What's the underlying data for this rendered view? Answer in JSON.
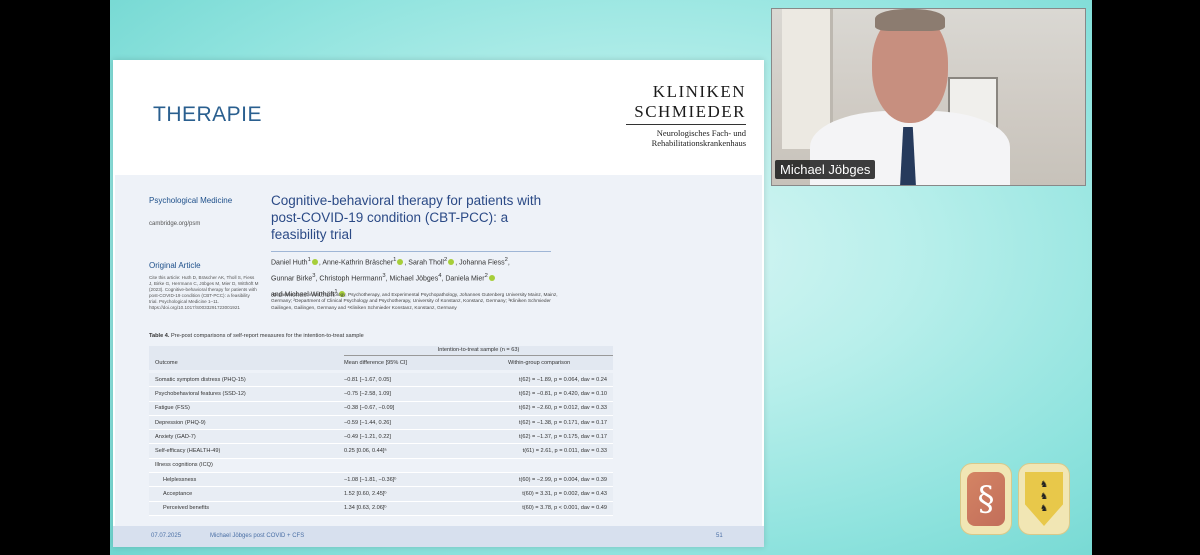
{
  "slide": {
    "title": "THERAPIE",
    "logo": {
      "line1": "KLINIKEN",
      "line2": "SCHMIEDER",
      "sub1": "Neurologisches Fach- und",
      "sub2": "Rehabilitationskrankenhaus"
    },
    "paper": {
      "journal": "Psychological Medicine",
      "journal_url": "cambridge.org/psm",
      "article_type": "Original Article",
      "citation": "Cite this article: Huth D, Bräscher AK, Tholl S, Fiess J, Birke G, Herrmann C, Jöbges M, Mier D, Witthöft M (2023). Cognitive-behavioral therapy for patients with post-COVID-19 condition (CBT-PCC): a feasibility trial. Psychological Medicine 1–11. https://doi.org/10.1017/S0033291723001921",
      "title": "Cognitive-behavioral therapy for patients with post-COVID-19 condition (CBT-PCC): a feasibility trial",
      "authors_line1a": "Daniel Huth",
      "authors_line1b": ", Anne-Kathrin Bräscher",
      "authors_line1c": ", Sarah Tholl",
      "authors_line1d": ", Johanna Fiess",
      "authors_line2a": "Gunnar Birke",
      "authors_line2b": ", Christoph Herrmann",
      "authors_line2c": ", Michael Jöbges",
      "authors_line2d": ", Daniela Mier",
      "authors_line3a": "and Michael Witthöft",
      "affiliations": "¹Department of Clinical Psychology, Psychotherapy, and Experimental Psychopathology, Johannes Gutenberg University Mainz, Mainz, Germany; ²Department of Clinical Psychology and Psychotherapy, University of Konstanz, Konstanz, Germany; ³Kliniken Schmieder Gailingen, Gailingen, Germany and ⁴Kliniken Schmieder Konstanz, Konstanz, Germany"
    },
    "table": {
      "caption_bold": "Table 4.",
      "caption_rest": " Pre-post comparisons of self-report measures for the intention-to-treat sample",
      "group_header": "Intention-to-treat sample (n = 63)",
      "headers": {
        "outcome": "Outcome",
        "mean": "Mean difference [95% CI]",
        "within": "Within-group comparison"
      },
      "rows": [
        {
          "outcome": "Somatic symptom distress (PHQ-15)",
          "mean": "−0.81 [−1.67, 0.05]",
          "within": "t(62) = −1.89, p = 0.064, dav = 0.24"
        },
        {
          "outcome": "Psychobehavioral features (SSD-12)",
          "mean": "−0.75 [−2.58, 1.09]",
          "within": "t(62) = −0.81, p = 0.420, dav = 0.10"
        },
        {
          "outcome": "Fatigue (FSS)",
          "mean": "−0.38 [−0.67, −0.09]",
          "within": "t(62) = −2.60, p = 0.012, dav = 0.33"
        },
        {
          "outcome": "Depression (PHQ-9)",
          "mean": "−0.59 [−1.44, 0.26]",
          "within": "t(62) = −1.38, p = 0.171, dav = 0.17"
        },
        {
          "outcome": "Anxiety (GAD-7)",
          "mean": "−0.49 [−1.21, 0.22]",
          "within": "t(62) = −1.37, p = 0.175, dav = 0.17"
        },
        {
          "outcome": "Self-efficacy (HEALTH-49)",
          "mean": "0.25 [0.06, 0.44]ᵃ",
          "within": "t(61) = 2.61, p = 0.011, dav = 0.33"
        },
        {
          "outcome": "Illness cognitions (ICQ)",
          "mean": "",
          "within": ""
        },
        {
          "outcome": "Helplessness",
          "mean": "−1.08 [−1.81, −0.36]ᵇ",
          "within": "t(60) = −2.99, p = 0.004, dav = 0.39"
        },
        {
          "outcome": "Acceptance",
          "mean": "1.52 [0.60, 2.45]ᵇ",
          "within": "t(60) = 3.31, p = 0.002, dav = 0.43"
        },
        {
          "outcome": "Perceived benefits",
          "mean": "1.34 [0.63, 2.06]ᵇ",
          "within": "t(60) = 3.78, p < 0.001, dav = 0.49"
        }
      ]
    },
    "footer": {
      "date": "07.07.2025",
      "presenter": "Michael Jöbges post COVID + CFS",
      "page": "51"
    }
  },
  "video": {
    "name": "Michael Jöbges"
  },
  "colors": {
    "background": "#b8efeb",
    "title": "#2a5f8f",
    "paper_title": "#2b4a86",
    "orcid": "#a6ce39"
  }
}
